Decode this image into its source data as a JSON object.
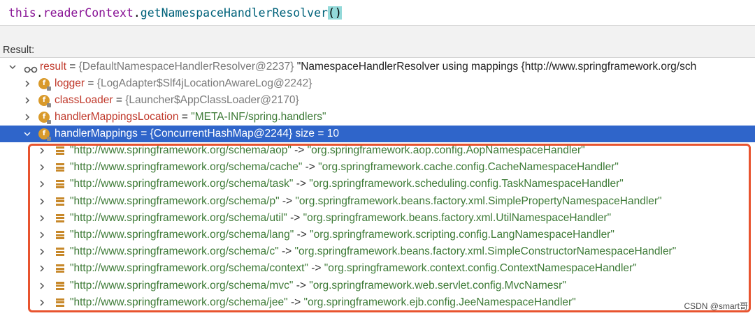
{
  "expression": {
    "this_kw": "this",
    "dot1": ".",
    "field": "readerContext",
    "dot2": ".",
    "method": "getNamespaceHandlerResolver",
    "open_paren": "(",
    "close_paren": ")"
  },
  "result_label": "Result:",
  "root": {
    "name": "result",
    "eq": " = ",
    "ref": "{DefaultNamespaceHandlerResolver@2237}",
    "value": " \"NamespaceHandlerResolver using mappings {http://www.springframework.org/sch"
  },
  "fields": [
    {
      "name": "logger",
      "eq": " = ",
      "value": "{LogAdapter$Slf4jLocationAwareLog@2242}",
      "value_kind": "ref"
    },
    {
      "name": "classLoader",
      "eq": " = ",
      "value": "{Launcher$AppClassLoader@2170}",
      "value_kind": "ref"
    },
    {
      "name": "handlerMappingsLocation",
      "eq": " = ",
      "value": "\"META-INF/spring.handlers\"",
      "value_kind": "string"
    }
  ],
  "selected": {
    "name": "handlerMappings",
    "text": " = {ConcurrentHashMap@2244}  size = 10"
  },
  "entries": [
    {
      "key": "\"http://www.springframework.org/schema/aop\"",
      "arrow": " -> ",
      "value": "\"org.springframework.aop.config.AopNamespaceHandler\""
    },
    {
      "key": "\"http://www.springframework.org/schema/cache\"",
      "arrow": " -> ",
      "value": "\"org.springframework.cache.config.CacheNamespaceHandler\""
    },
    {
      "key": "\"http://www.springframework.org/schema/task\"",
      "arrow": " -> ",
      "value": "\"org.springframework.scheduling.config.TaskNamespaceHandler\""
    },
    {
      "key": "\"http://www.springframework.org/schema/p\"",
      "arrow": " -> ",
      "value": "\"org.springframework.beans.factory.xml.SimplePropertyNamespaceHandler\""
    },
    {
      "key": "\"http://www.springframework.org/schema/util\"",
      "arrow": " -> ",
      "value": "\"org.springframework.beans.factory.xml.UtilNamespaceHandler\""
    },
    {
      "key": "\"http://www.springframework.org/schema/lang\"",
      "arrow": " -> ",
      "value": "\"org.springframework.scripting.config.LangNamespaceHandler\""
    },
    {
      "key": "\"http://www.springframework.org/schema/c\"",
      "arrow": " -> ",
      "value": "\"org.springframework.beans.factory.xml.SimpleConstructorNamespaceHandler\""
    },
    {
      "key": "\"http://www.springframework.org/schema/context\"",
      "arrow": " -> ",
      "value": "\"org.springframework.context.config.ContextNamespaceHandler\""
    },
    {
      "key": "\"http://www.springframework.org/schema/mvc\"",
      "arrow": " -> ",
      "value": "\"org.springframework.web.servlet.config.MvcNamesr\""
    },
    {
      "key": "\"http://www.springframework.org/schema/jee\"",
      "arrow": " -> ",
      "value": "\"org.springframework.ejb.config.JeeNamespaceHandler\""
    }
  ],
  "icons": {
    "root": "watch-glasses-icon",
    "field": "field-f-icon",
    "entry": "map-entry-icon",
    "expand": "chevron-right-icon",
    "collapse": "chevron-down-icon"
  },
  "colors": {
    "selection": "#2f65ca",
    "field_badge": "#d99a2b",
    "highlight_border": "#e8542f",
    "field_name": "#c0392b",
    "string_value": "#3d7a36"
  },
  "watermark": "CSDN @smart哥"
}
